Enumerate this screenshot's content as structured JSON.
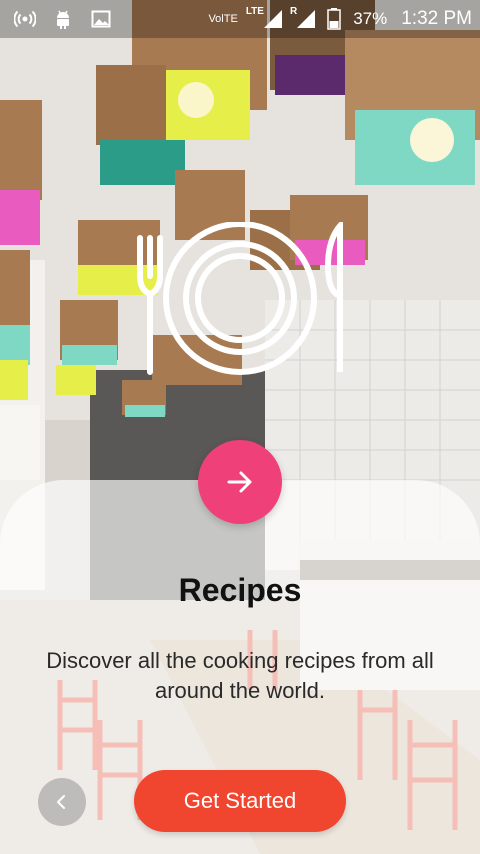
{
  "status_bar": {
    "network_type": "VolTE",
    "signal_label_1": "LTE",
    "signal_label_2": "R",
    "battery": "37%",
    "time": "1:32 PM",
    "icons": [
      "hotspot-icon",
      "android-icon",
      "image-icon",
      "signal-icon",
      "battery-icon"
    ]
  },
  "onboarding": {
    "title": "Recipes",
    "description": "Discover all the cooking recipes from all around the world.",
    "cta_label": "Get Started",
    "accent_color": "#f0407a",
    "cta_color": "#f0452f"
  }
}
